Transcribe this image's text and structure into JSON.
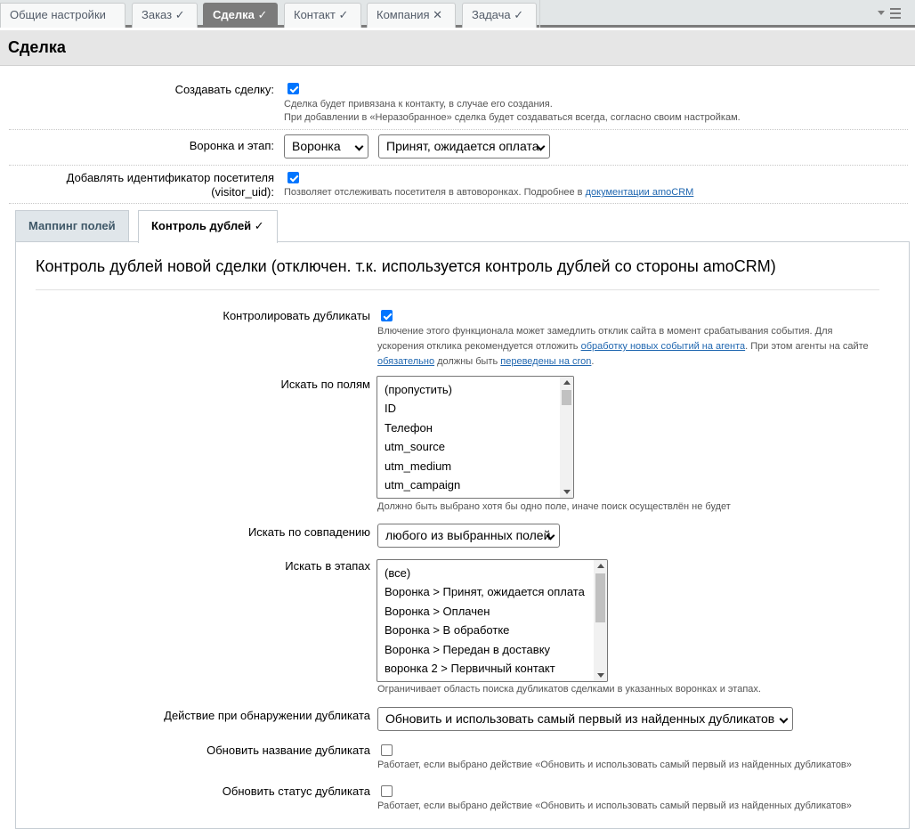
{
  "top_tabs": [
    {
      "label": "Общие настройки",
      "mark": ""
    },
    {
      "label": "Заказ",
      "mark": "✓"
    },
    {
      "label": "Сделка",
      "mark": "✓"
    },
    {
      "label": "Контакт",
      "mark": "✓"
    },
    {
      "label": "Компания",
      "mark": "✕"
    },
    {
      "label": "Задача",
      "mark": "✓"
    }
  ],
  "menu_icon": "menu-icon",
  "section_title": "Сделка",
  "create_deal": {
    "label": "Создавать сделку:",
    "checked": true,
    "hint1": "Сделка будет привязана к контакту, в случае его создания.",
    "hint2": "При добавлении в «Неразобранное» сделка будет создаваться всегда, согласно своим настройкам."
  },
  "funnel": {
    "label": "Воронка и этап:",
    "pipeline_value": "Воронка",
    "stage_value": "Принят, ожидается оплата"
  },
  "visitor_uid": {
    "label_line1": "Добавлять идентификатор посетителя",
    "label_line2": "(visitor_uid):",
    "checked": true,
    "hint_text": "Позволяет отслеживать посетителя в автоворонках. Подробнее в ",
    "hint_link": "документации amoCRM"
  },
  "inner_tabs": [
    {
      "label": "Маппинг полей"
    },
    {
      "label": "Контроль дублей ✓"
    }
  ],
  "panel": {
    "title": "Контроль дублей новой сделки (отключен. т.к. используется контроль дублей со стороны amoCRM)",
    "control_duplicates": {
      "label": "Контролировать дубликаты",
      "checked": true,
      "hint_part1": "Влючение этого функционала может замедлить отклик сайта в момент срабатывания события. Для",
      "hint_part2a": "ускорения отклика рекомендуется отложить ",
      "hint_link1": "обработку новых событий на агента",
      "hint_part2b": ". При этом агенты на сайте",
      "hint_link2": "обязательно",
      "hint_part3a": " должны быть ",
      "hint_link3": "переведены на cron",
      "hint_part3b": "."
    },
    "search_fields": {
      "label": "Искать по полям",
      "options": [
        "(пропустить)",
        "ID",
        "Телефон",
        "utm_source",
        "utm_medium",
        "utm_campaign"
      ],
      "hint": "Должно быть выбрано хотя бы одно поле, иначе поиск осуществлён не будет"
    },
    "match": {
      "label": "Искать по совпадению",
      "value": "любого из выбранных полей"
    },
    "stages": {
      "label": "Искать в этапах",
      "options": [
        "(все)",
        "Воронка > Принят, ожидается оплата",
        "Воронка > Оплачен",
        "Воронка > В обработке",
        "Воронка > Передан в доставку",
        "воронка 2 > Первичный контакт"
      ],
      "hint": "Ограничивает область поиска дубликатов сделками в указанных воронках и этапах."
    },
    "action": {
      "label": "Действие при обнаружении дубликата",
      "value": "Обновить и использовать самый первый из найденных дубликатов"
    },
    "update_name": {
      "label": "Обновить название дубликата",
      "checked": false,
      "hint": "Работает, если выбрано действие «Обновить и использовать самый первый из найденных дубликатов»"
    },
    "update_status": {
      "label": "Обновить статус дубликата",
      "checked": false,
      "hint": "Работает, если выбрано действие «Обновить и использовать самый первый из найденных дубликатов»"
    }
  }
}
